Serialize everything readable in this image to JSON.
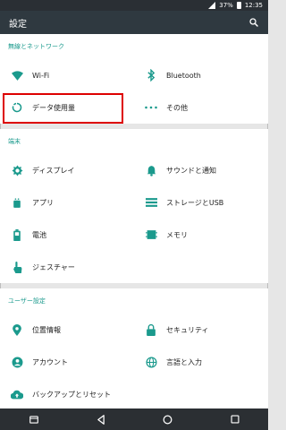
{
  "status_bar": {
    "battery": "37%",
    "time": "12:35"
  },
  "toolbar": {
    "title": "設定"
  },
  "sections": [
    {
      "header": "無線とネットワーク",
      "items": [
        {
          "label": "Wi-Fi",
          "icon": "wifi-icon"
        },
        {
          "label": "Bluetooth",
          "icon": "bluetooth-icon"
        },
        {
          "label": "データ使用量",
          "icon": "data-usage-icon"
        },
        {
          "label": "その他",
          "icon": "more-icon"
        }
      ]
    },
    {
      "header": "端末",
      "items": [
        {
          "label": "ディスプレイ",
          "icon": "display-icon"
        },
        {
          "label": "サウンドと通知",
          "icon": "bell-icon"
        },
        {
          "label": "アプリ",
          "icon": "apps-icon"
        },
        {
          "label": "ストレージとUSB",
          "icon": "storage-icon"
        },
        {
          "label": "電池",
          "icon": "battery-icon"
        },
        {
          "label": "メモリ",
          "icon": "memory-icon"
        },
        {
          "label": "ジェスチャー",
          "icon": "gesture-icon"
        }
      ]
    },
    {
      "header": "ユーザー設定",
      "items": [
        {
          "label": "位置情報",
          "icon": "location-icon"
        },
        {
          "label": "セキュリティ",
          "icon": "lock-icon"
        },
        {
          "label": "アカウント",
          "icon": "account-icon"
        },
        {
          "label": "言語と入力",
          "icon": "globe-icon"
        },
        {
          "label": "バックアップとリセット",
          "icon": "cloud-backup-icon"
        }
      ]
    }
  ],
  "colors": {
    "accent": "#1b9a8d",
    "icon": "#1b9a8d",
    "toolbar": "#2f3940",
    "highlight": "#dd0000"
  }
}
